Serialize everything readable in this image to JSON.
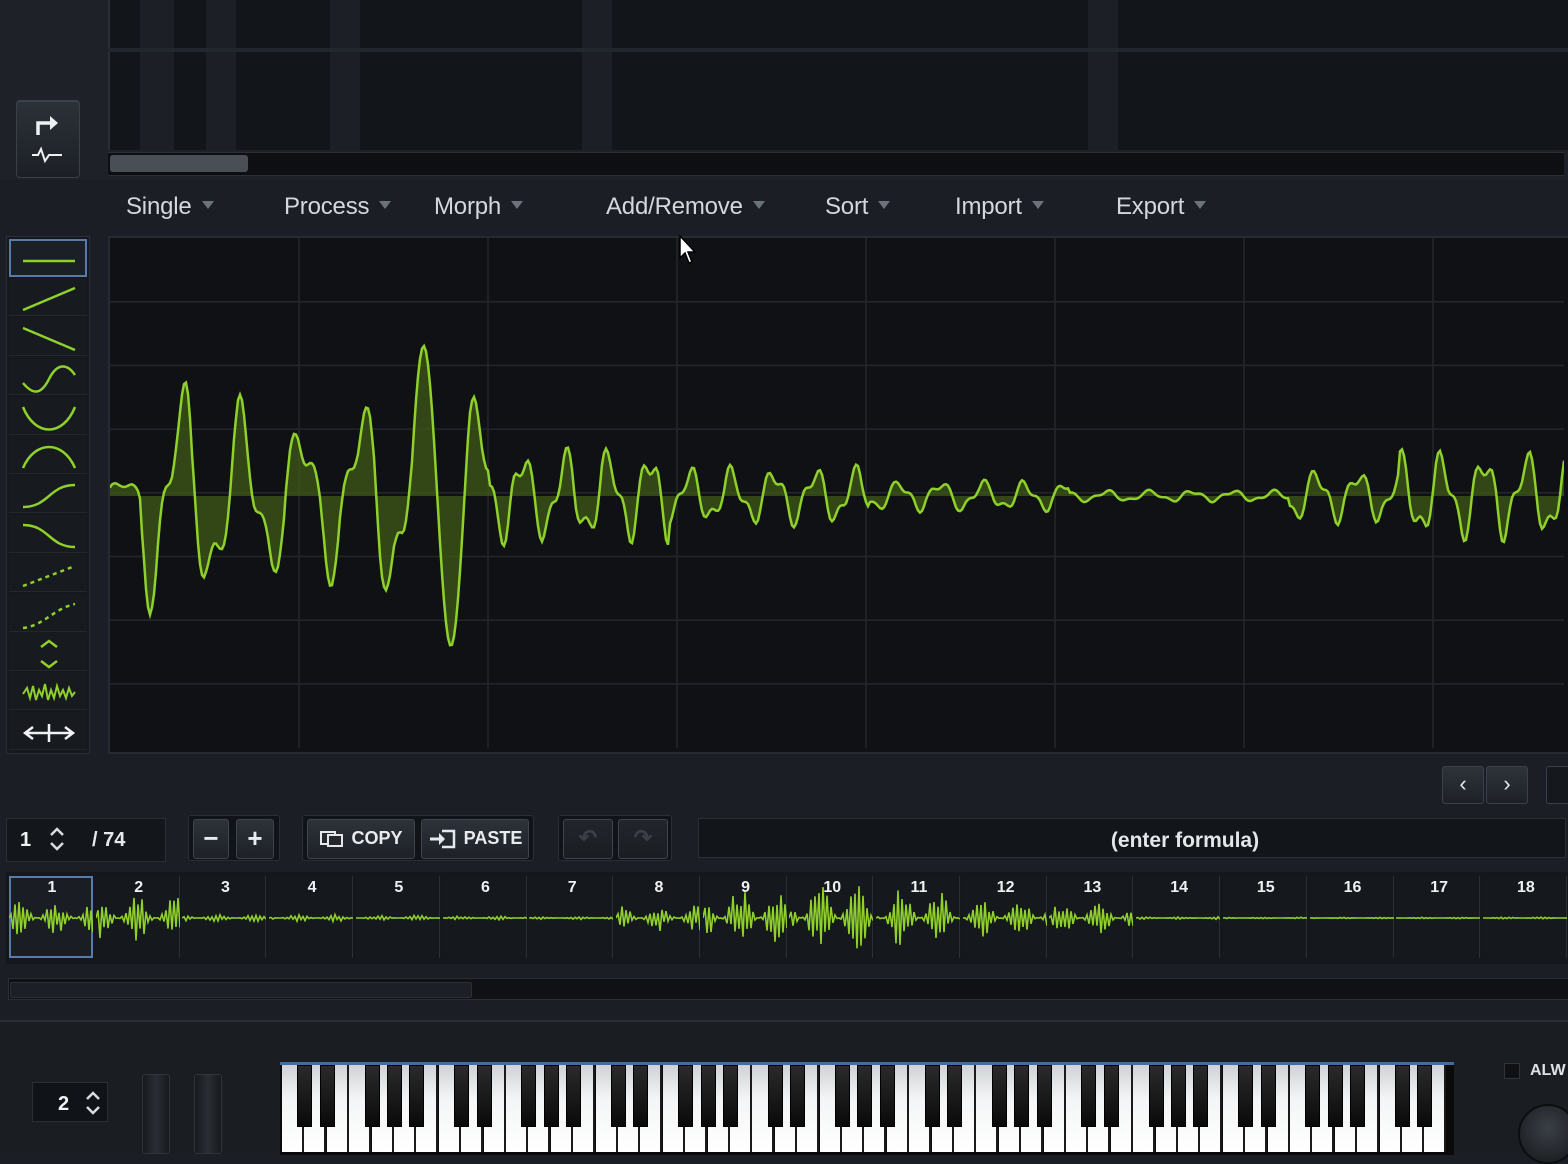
{
  "menu": {
    "items": [
      {
        "label": "Single"
      },
      {
        "label": "Process"
      },
      {
        "label": "Morph"
      },
      {
        "label": "Add/Remove"
      },
      {
        "label": "Sort"
      },
      {
        "label": "Import"
      },
      {
        "label": "Export"
      }
    ]
  },
  "tools": [
    {
      "icon": "flat-line-icon",
      "selected": true
    },
    {
      "icon": "ramp-up-icon"
    },
    {
      "icon": "ramp-down-icon"
    },
    {
      "icon": "sine-icon"
    },
    {
      "icon": "valley-curve-icon"
    },
    {
      "icon": "peak-curve-icon"
    },
    {
      "icon": "s-curve-up-icon"
    },
    {
      "icon": "s-curve-down-icon"
    },
    {
      "icon": "dotted-ramp-icon"
    },
    {
      "icon": "dotted-curve-icon"
    },
    {
      "icon": "expand-vertical-icon"
    },
    {
      "icon": "noise-icon"
    },
    {
      "icon": "stretch-horizontal-icon"
    }
  ],
  "controls": {
    "frame_index": "1",
    "frame_total": "/ 74",
    "minus_label": "−",
    "plus_label": "+",
    "copy_label": "COPY",
    "paste_label": "PASTE",
    "formula_placeholder": "(enter formula)"
  },
  "thumbnails": [
    {
      "label": "1",
      "energy": 0.5,
      "selected": true
    },
    {
      "label": "2",
      "energy": 0.7
    },
    {
      "label": "3",
      "energy": 0.12
    },
    {
      "label": "4",
      "energy": 0.12
    },
    {
      "label": "5",
      "energy": 0.08
    },
    {
      "label": "6",
      "energy": 0.06
    },
    {
      "label": "7",
      "energy": 0.05
    },
    {
      "label": "8",
      "energy": 0.4
    },
    {
      "label": "9",
      "energy": 0.95
    },
    {
      "label": "10",
      "energy": 1.0
    },
    {
      "label": "11",
      "energy": 0.95
    },
    {
      "label": "12",
      "energy": 0.6
    },
    {
      "label": "13",
      "energy": 0.5
    },
    {
      "label": "14",
      "energy": 0.04
    },
    {
      "label": "15",
      "energy": 0.02
    },
    {
      "label": "16",
      "energy": 0.02
    },
    {
      "label": "17",
      "energy": 0.02
    },
    {
      "label": "18",
      "energy": 0.03
    }
  ],
  "keyboard": {
    "octave_value": "2",
    "alw_label": "ALW"
  },
  "colors": {
    "wave": "#8fd12a",
    "wave_fill": "#3f5a16",
    "grid": "#23272d",
    "accent_blue": "#5a7aa8"
  }
}
